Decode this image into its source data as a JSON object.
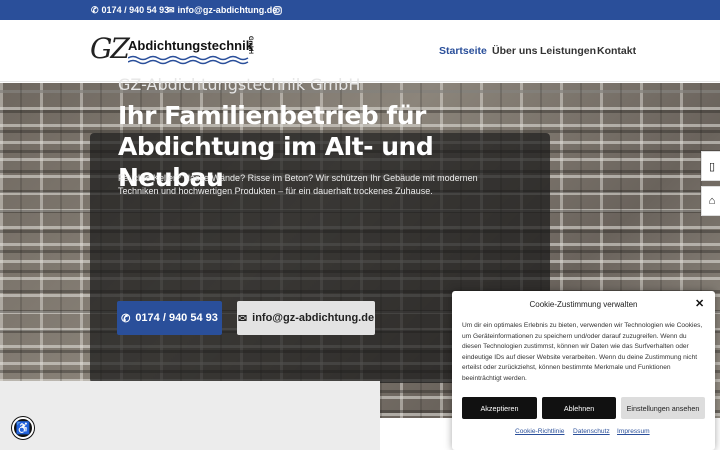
{
  "topbar": {
    "phone": "0174 / 940 54 93",
    "email": "info@gz-abdichtung.de",
    "icons": {
      "phone": "phone-icon",
      "email": "envelope-icon",
      "instagram": "instagram-icon"
    }
  },
  "logo": {
    "gz": "GZ",
    "name": "Abdichtungstechnik",
    "gmbh": "GmbH"
  },
  "nav": {
    "items": [
      {
        "label": "Startseite",
        "active": true
      },
      {
        "label": "Über uns",
        "active": false
      },
      {
        "label": "Leistungen",
        "active": false
      },
      {
        "label": "Kontakt",
        "active": false
      }
    ]
  },
  "hero": {
    "subtitle": "GZ-Abdichtungstechnik GmbH",
    "title": "Ihr Familienbetrieb für Abdichtung im Alt- und Neubau",
    "text": "Feuchte Keller? Nasse Wände? Risse im Beton? Wir schützen Ihr Gebäude mit modernen Techniken und hochwertigen Produkten – für ein dauerhaft trockenes Zuhause.",
    "btn_phone": "0174 / 940 54 93",
    "btn_mail": "info@gz-abdichtung.de"
  },
  "side": {
    "phone_icon": "mobile-phone-icon",
    "home_icon": "home-icon"
  },
  "cookie": {
    "title": "Cookie-Zustimmung verwalten",
    "text": "Um dir ein optimales Erlebnis zu bieten, verwenden wir Technologien wie Cookies, um Geräteinformationen zu speichern und/oder darauf zuzugreifen. Wenn du diesen Technologien zustimmst, können wir Daten wie das Surfverhalten oder eindeutige IDs auf dieser Website verarbeiten. Wenn du deine Zustimmung nicht erteilst oder zurückziehst, können bestimmte Merkmale und Funktionen beeinträchtigt werden.",
    "accept": "Akzeptieren",
    "deny": "Ablehnen",
    "settings": "Einstellungen ansehen",
    "links": [
      "Cookie-Richtlinie",
      "Datenschutz",
      "Impressum"
    ]
  },
  "colors": {
    "brand": "#2a4f9a",
    "dark": "#111111"
  }
}
